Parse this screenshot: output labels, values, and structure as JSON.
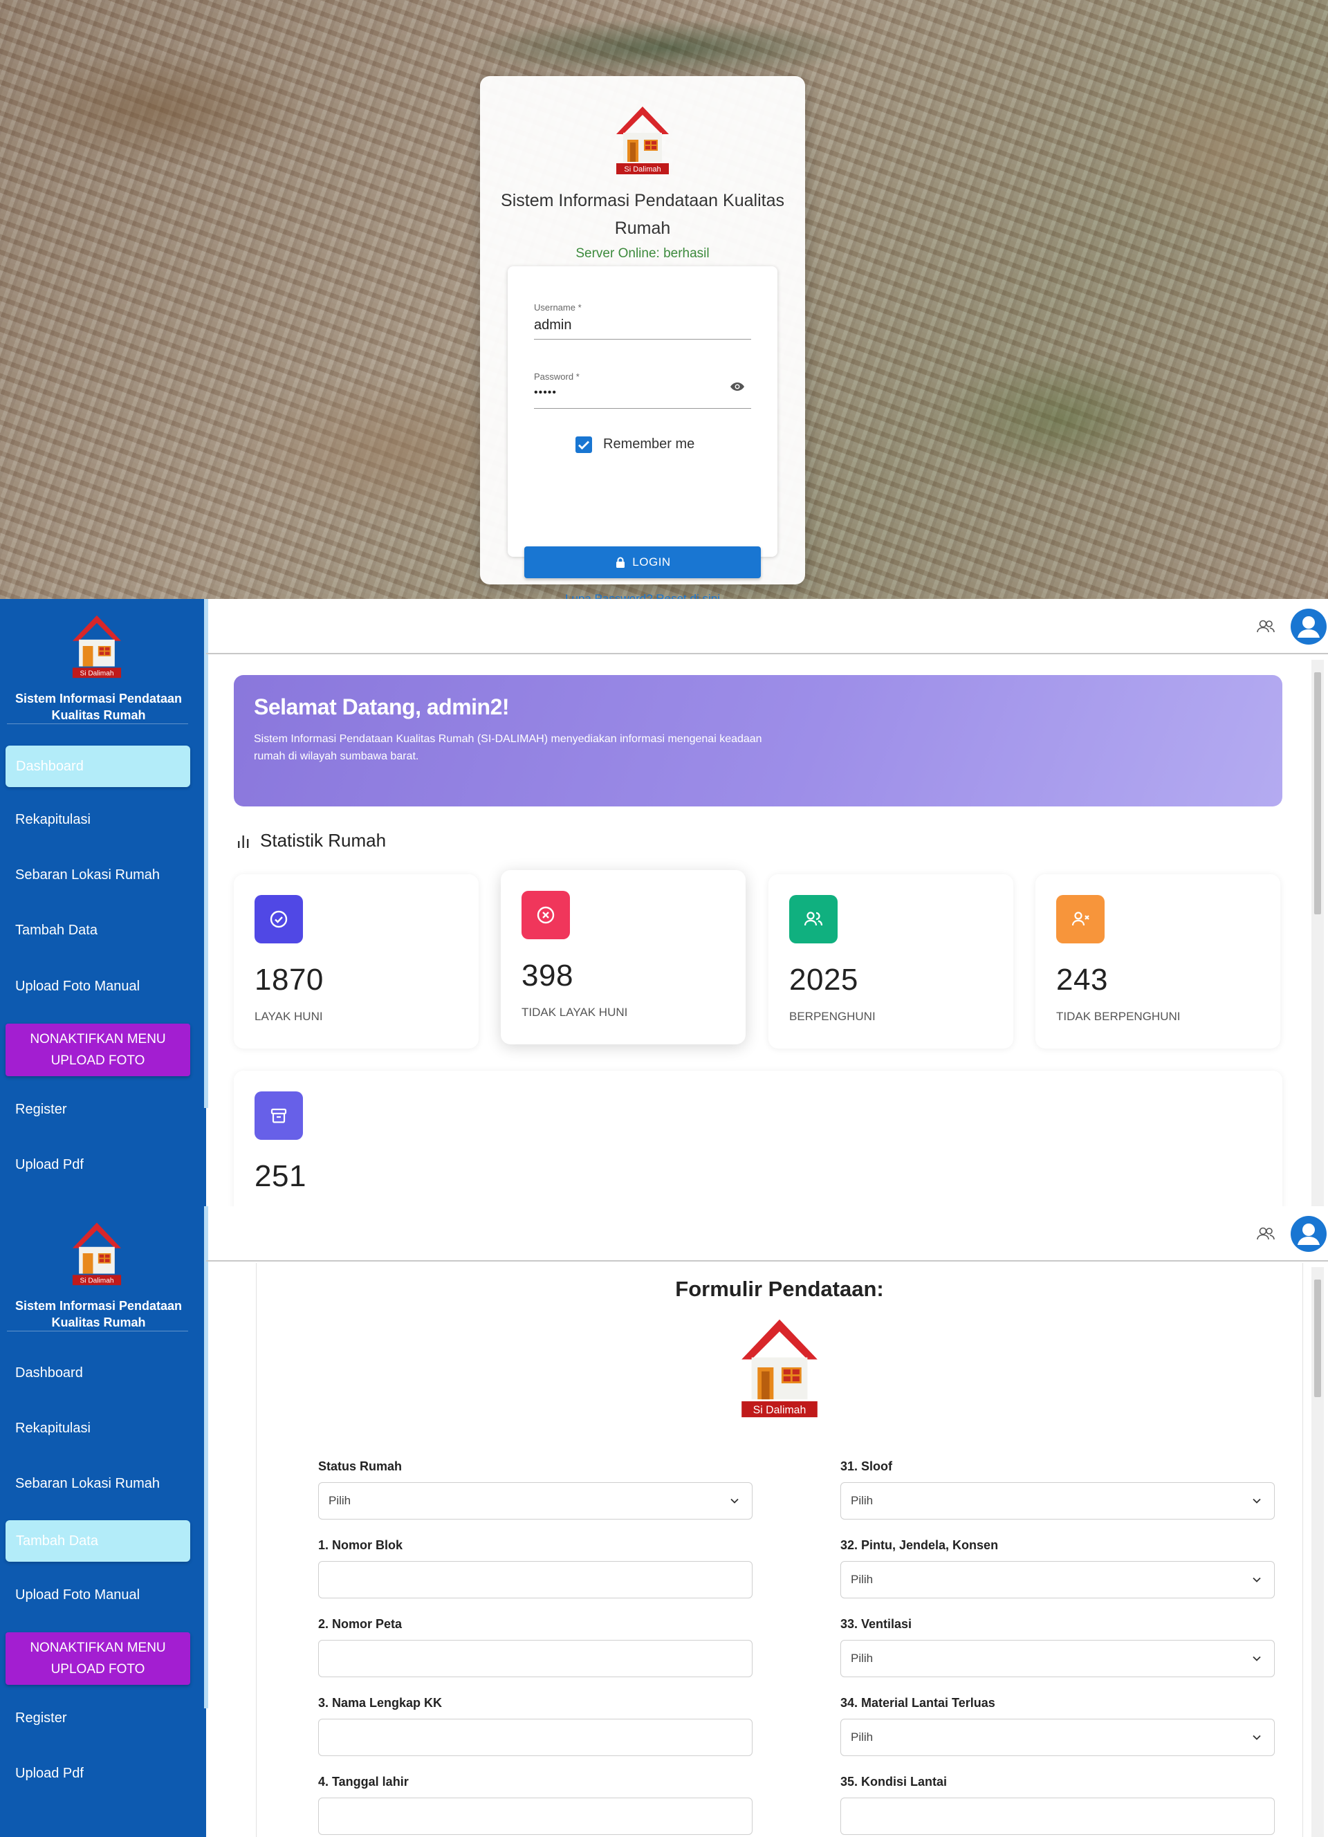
{
  "login": {
    "title": "Sistem Informasi Pendataan Kualitas Rumah",
    "server_status": "Server Online: berhasil",
    "logo_text": "Si Dalimah",
    "username_label": "Username",
    "username_value": "admin",
    "password_label": "Password",
    "password_value": "•••••",
    "required_mark": "*",
    "remember_label": "Remember me",
    "remember_checked": true,
    "login_button": "LOGIN",
    "reset_link": "Lupa Password? Reset di sini"
  },
  "sidebar": {
    "logo_text": "Si Dalimah",
    "title": "Sistem Informasi Pendataan Kualitas Rumah",
    "items": [
      {
        "label": "Dashboard"
      },
      {
        "label": "Rekapitulasi"
      },
      {
        "label": "Sebaran Lokasi Rumah"
      },
      {
        "label": "Tambah Data"
      },
      {
        "label": "Upload Foto Manual"
      },
      {
        "label": "NONAKTIFKAN MENU UPLOAD FOTO"
      },
      {
        "label": "Register"
      },
      {
        "label": "Upload Pdf"
      }
    ]
  },
  "dashboard": {
    "active_item": "Dashboard",
    "welcome_title": "Selamat Datang, admin2!",
    "welcome_text": "Sistem Informasi Pendataan Kualitas Rumah (SI-DALIMAH) menyediakan informasi mengenai keadaan rumah di wilayah sumbawa barat.",
    "stat_heading": "Statistik Rumah",
    "stats": [
      {
        "value": "1870",
        "label": "LAYAK HUNI",
        "color": "#5048e5",
        "icon": "check-circle-icon"
      },
      {
        "value": "398",
        "label": "TIDAK LAYAK HUNI",
        "color": "#f0365b",
        "icon": "x-circle-icon"
      },
      {
        "value": "2025",
        "label": "BERPENGHUNI",
        "color": "#10b07f",
        "icon": "users-icon"
      },
      {
        "value": "243",
        "label": "TIDAK BERPENGHUNI",
        "color": "#f7953b",
        "icon": "user-x-icon"
      },
      {
        "value": "251",
        "label": "",
        "color": "#6760e8",
        "icon": "archive-icon"
      }
    ]
  },
  "form": {
    "active_item": "Tambah Data",
    "title": "Formulir Pendataan:",
    "logo_text": "Si Dalimah",
    "select_placeholder": "Pilih",
    "left_fields": [
      {
        "label": "Status Rumah",
        "type": "select",
        "value": "Pilih"
      },
      {
        "label": "1. Nomor Blok",
        "type": "text",
        "value": ""
      },
      {
        "label": "2. Nomor Peta",
        "type": "text",
        "value": ""
      },
      {
        "label": "3. Nama Lengkap KK",
        "type": "text",
        "value": ""
      },
      {
        "label": "4. Tanggal lahir",
        "type": "text",
        "value": ""
      }
    ],
    "right_fields": [
      {
        "label": "31. Sloof",
        "type": "select",
        "value": "Pilih"
      },
      {
        "label": "32. Pintu, Jendela, Konsen",
        "type": "select",
        "value": "Pilih"
      },
      {
        "label": "33. Ventilasi",
        "type": "select",
        "value": "Pilih"
      },
      {
        "label": "34. Material Lantai Terluas",
        "type": "select",
        "value": "Pilih"
      },
      {
        "label": "35. Kondisi Lantai",
        "type": "select",
        "value": ""
      }
    ]
  },
  "colors": {
    "sidebar": "#0d5ab0",
    "primary": "#1976d2",
    "active_item": "#b3ecf9",
    "toggle_button": "#a31ed1",
    "server_ok": "#3c8a3c"
  }
}
